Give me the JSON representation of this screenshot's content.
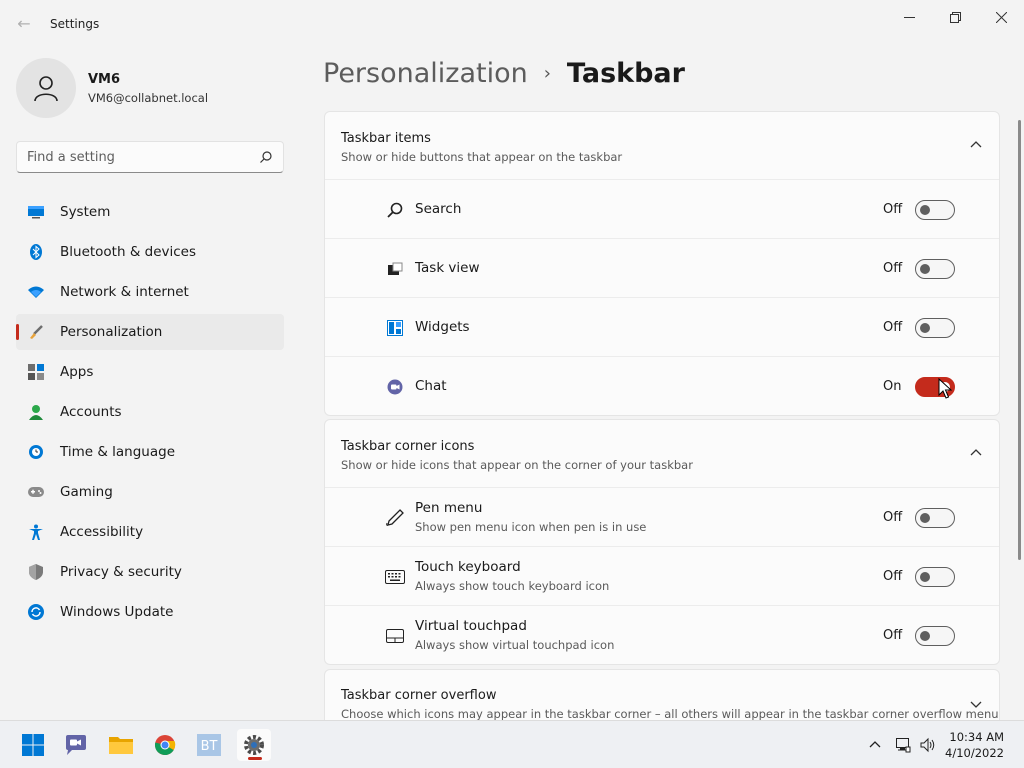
{
  "window": {
    "title": "Settings"
  },
  "profile": {
    "name": "VM6",
    "email": "VM6@collabnet.local"
  },
  "search": {
    "placeholder": "Find a setting"
  },
  "sidebar": {
    "items": [
      {
        "label": "System",
        "icon": "system-icon",
        "active": false
      },
      {
        "label": "Bluetooth & devices",
        "icon": "bluetooth-icon",
        "active": false
      },
      {
        "label": "Network & internet",
        "icon": "wifi-icon",
        "active": false
      },
      {
        "label": "Personalization",
        "icon": "brush-icon",
        "active": true
      },
      {
        "label": "Apps",
        "icon": "apps-icon",
        "active": false
      },
      {
        "label": "Accounts",
        "icon": "accounts-icon",
        "active": false
      },
      {
        "label": "Time & language",
        "icon": "clock-globe-icon",
        "active": false
      },
      {
        "label": "Gaming",
        "icon": "gamepad-icon",
        "active": false
      },
      {
        "label": "Accessibility",
        "icon": "accessibility-icon",
        "active": false
      },
      {
        "label": "Privacy & security",
        "icon": "shield-icon",
        "active": false
      },
      {
        "label": "Windows Update",
        "icon": "update-icon",
        "active": false
      }
    ]
  },
  "breadcrumb": {
    "parent": "Personalization",
    "separator": "›",
    "current": "Taskbar"
  },
  "sections": {
    "taskbar_items": {
      "title": "Taskbar items",
      "description": "Show or hide buttons that appear on the taskbar",
      "expanded": true,
      "rows": [
        {
          "label": "Search",
          "icon": "search-icon",
          "state": "Off",
          "on": false
        },
        {
          "label": "Task view",
          "icon": "task-view-icon",
          "state": "Off",
          "on": false
        },
        {
          "label": "Widgets",
          "icon": "widgets-icon",
          "state": "Off",
          "on": false
        },
        {
          "label": "Chat",
          "icon": "chat-icon",
          "state": "On",
          "on": true
        }
      ]
    },
    "corner_icons": {
      "title": "Taskbar corner icons",
      "description": "Show or hide icons that appear on the corner of your taskbar",
      "expanded": true,
      "rows": [
        {
          "label": "Pen menu",
          "sub": "Show pen menu icon when pen is in use",
          "icon": "pen-icon",
          "state": "Off",
          "on": false
        },
        {
          "label": "Touch keyboard",
          "sub": "Always show touch keyboard icon",
          "icon": "keyboard-icon",
          "state": "Off",
          "on": false
        },
        {
          "label": "Virtual touchpad",
          "sub": "Always show virtual touchpad icon",
          "icon": "touchpad-icon",
          "state": "Off",
          "on": false
        }
      ]
    },
    "corner_overflow": {
      "title": "Taskbar corner overflow",
      "description": "Choose which icons may appear in the taskbar corner – all others will appear in the taskbar corner overflow menu",
      "expanded": false
    }
  },
  "taskbar": {
    "apps": [
      "start-icon",
      "chat-icon",
      "file-explorer-icon",
      "chrome-icon",
      "app-bt-icon",
      "settings-icon"
    ],
    "time": "10:34 AM",
    "date": "4/10/2022"
  },
  "colors": {
    "accent": "#c42b1c",
    "background": "#f3f3f3",
    "card": "#fbfbfb"
  }
}
